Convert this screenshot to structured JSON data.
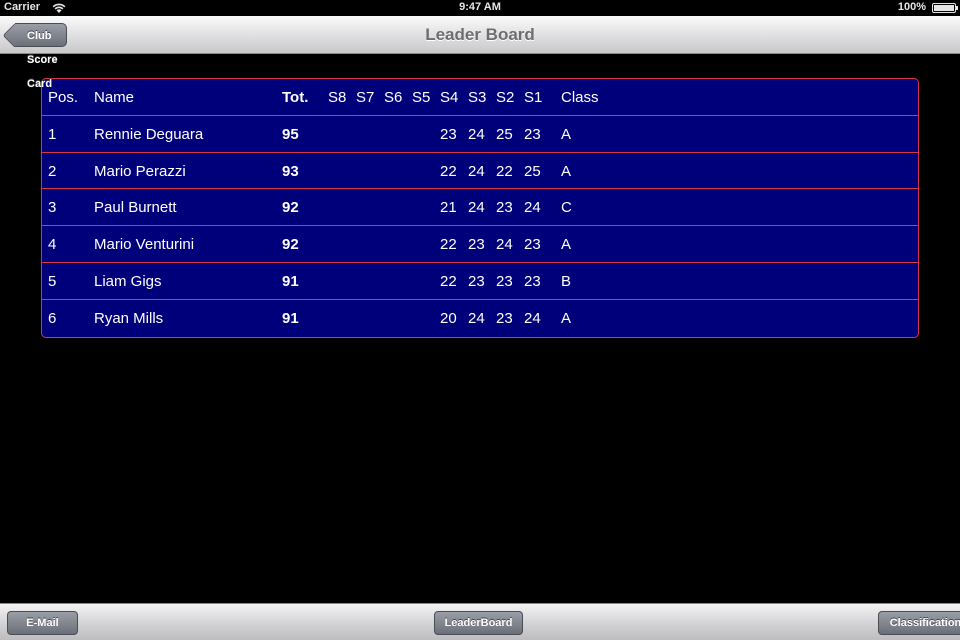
{
  "status_bar": {
    "carrier": "Carrier",
    "time": "9:47 AM",
    "battery": "100%",
    "battery_level": 1.0
  },
  "nav": {
    "title": "Leader Board",
    "back_label": "Club Score Card"
  },
  "table": {
    "columns": [
      "Pos.",
      "Name",
      "Tot.",
      "S8",
      "S7",
      "S6",
      "S5",
      "S4",
      "S3",
      "S2",
      "S1",
      "Class"
    ],
    "rows": [
      {
        "pos": "1",
        "name": "Rennie Deguara",
        "tot": "95",
        "s8": "",
        "s7": "",
        "s6": "",
        "s5": "",
        "s4": "23",
        "s3": "24",
        "s2": "25",
        "s1": "23",
        "class": "A"
      },
      {
        "pos": "2",
        "name": "Mario Perazzi",
        "tot": "93",
        "s8": "",
        "s7": "",
        "s6": "",
        "s5": "",
        "s4": "22",
        "s3": "24",
        "s2": "22",
        "s1": "25",
        "class": "A"
      },
      {
        "pos": "3",
        "name": "Paul Burnett",
        "tot": "92",
        "s8": "",
        "s7": "",
        "s6": "",
        "s5": "",
        "s4": "21",
        "s3": "24",
        "s2": "23",
        "s1": "24",
        "class": "C"
      },
      {
        "pos": "4",
        "name": "Mario Venturini",
        "tot": "92",
        "s8": "",
        "s7": "",
        "s6": "",
        "s5": "",
        "s4": "22",
        "s3": "23",
        "s2": "24",
        "s1": "23",
        "class": "A"
      },
      {
        "pos": "5",
        "name": "Liam Gigs",
        "tot": "91",
        "s8": "",
        "s7": "",
        "s6": "",
        "s5": "",
        "s4": "22",
        "s3": "23",
        "s2": "23",
        "s1": "23",
        "class": "B"
      },
      {
        "pos": "6",
        "name": "Ryan Mills",
        "tot": "91",
        "s8": "",
        "s7": "",
        "s6": "",
        "s5": "",
        "s4": "20",
        "s3": "24",
        "s2": "23",
        "s1": "24",
        "class": "A"
      }
    ]
  },
  "toolbar": {
    "email_label": "E-Mail",
    "leaderboard_label": "LeaderBoard",
    "classification_label": "Classification"
  },
  "colors": {
    "table_background": "#00007a",
    "table_border": "#d8344a",
    "background": "#000000"
  }
}
